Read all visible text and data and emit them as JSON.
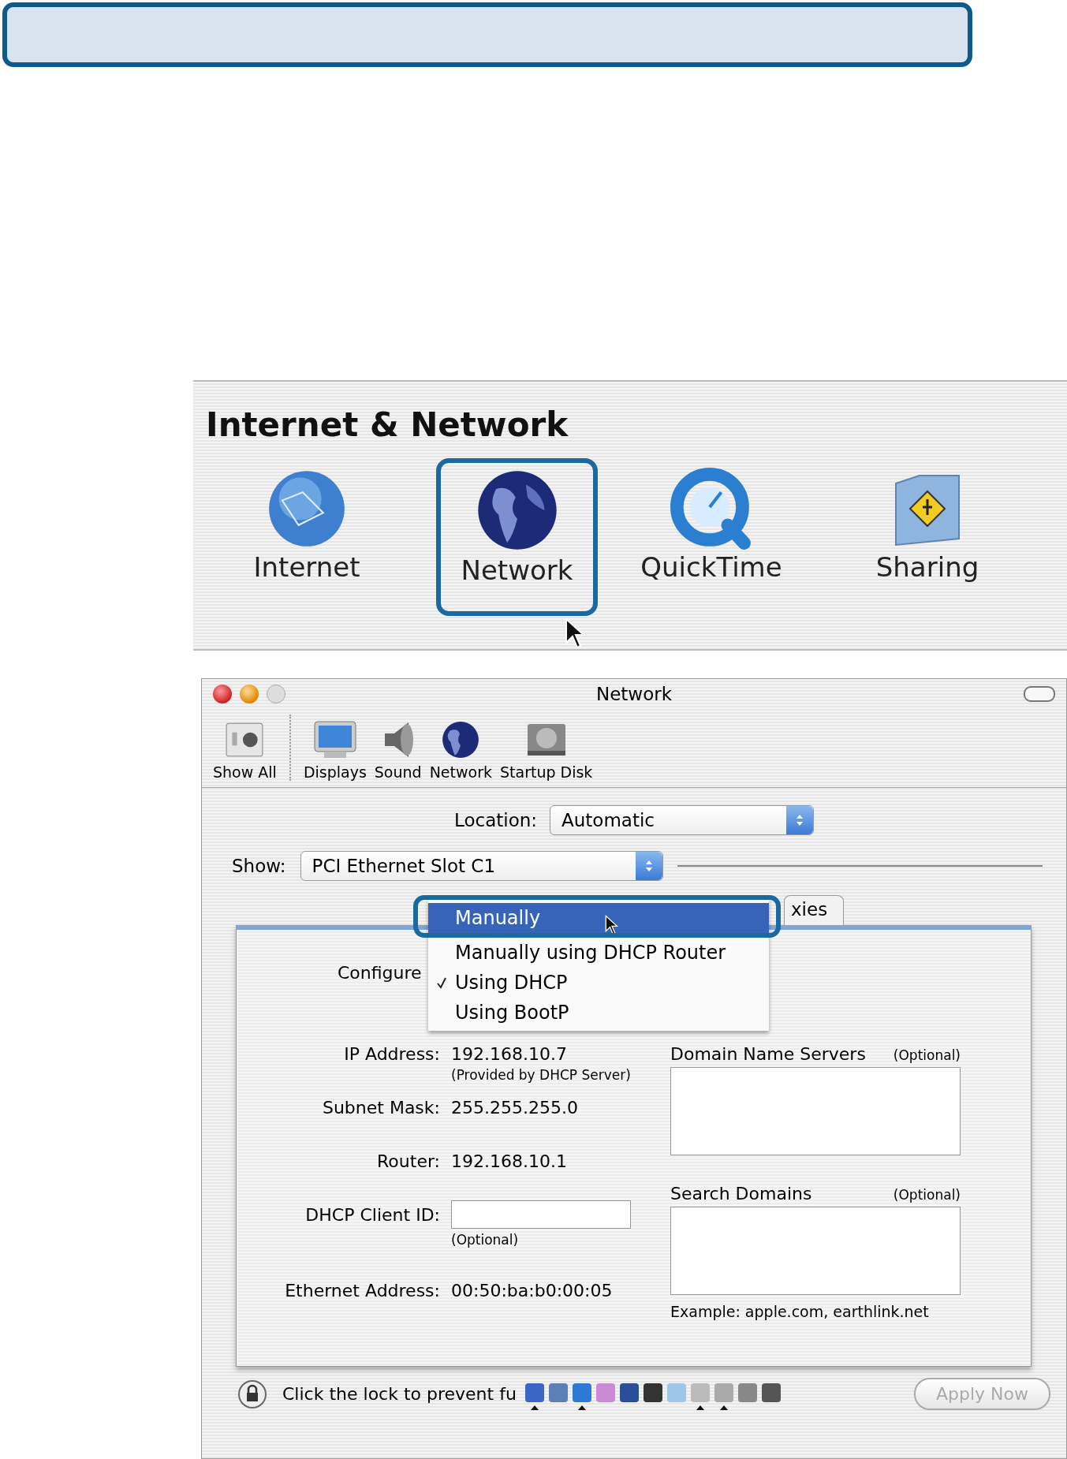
{
  "pref_pane": {
    "title": "Internet & Network",
    "items": [
      {
        "label": "Internet",
        "selected": false
      },
      {
        "label": "Network",
        "selected": true
      },
      {
        "label": "QuickTime",
        "selected": false
      },
      {
        "label": "Sharing",
        "selected": false
      }
    ]
  },
  "window": {
    "title": "Network",
    "toolbar": [
      {
        "label": "Show All"
      },
      {
        "label": "Displays"
      },
      {
        "label": "Sound"
      },
      {
        "label": "Network"
      },
      {
        "label": "Startup Disk"
      }
    ],
    "location": {
      "label": "Location:",
      "value": "Automatic"
    },
    "show": {
      "label": "Show:",
      "value": "PCI Ethernet Slot C1"
    },
    "tab": {
      "label": "xies"
    },
    "configure_label": "Configure",
    "menu": [
      {
        "label": "Manually",
        "selected": true,
        "checked": false
      },
      {
        "label": "Manually using DHCP Router",
        "selected": false,
        "checked": false
      },
      {
        "label": "Using DHCP",
        "selected": false,
        "checked": true
      },
      {
        "label": "Using BootP",
        "selected": false,
        "checked": false
      }
    ],
    "fields": [
      {
        "kind": "text",
        "label": "IP Address:",
        "value": "192.168.10.7",
        "note": "(Provided by DHCP Server)"
      },
      {
        "kind": "text",
        "label": "Subnet Mask:",
        "value": "255.255.255.0"
      },
      {
        "kind": "text",
        "label": "Router:",
        "value": "192.168.10.1"
      },
      {
        "kind": "input",
        "label": "DHCP Client ID:",
        "note": "(Optional)"
      },
      {
        "kind": "text",
        "label": "Ethernet Address:",
        "value": "00:50:ba:b0:00:05"
      }
    ],
    "dns": {
      "label": "Domain Name Servers",
      "note": "(Optional)"
    },
    "search_domains": {
      "label": "Search Domains",
      "note": "(Optional)"
    },
    "example": "Example: apple.com, earthlink.net",
    "lock_text": "Click the lock to prevent fu",
    "apply_button": {
      "label": "Apply Now",
      "disabled": true
    }
  }
}
